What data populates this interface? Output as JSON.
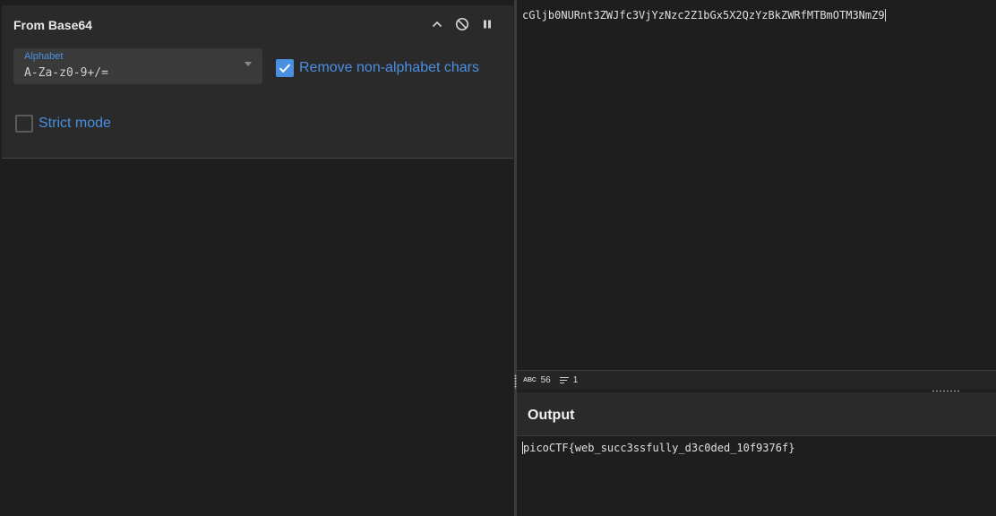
{
  "recipe": {
    "operation": {
      "title": "From Base64",
      "controls": {
        "collapse_icon": "chevron-up-icon",
        "disable_icon": "disable-icon",
        "pause_icon": "pause-icon"
      },
      "alphabet": {
        "label": "Alphabet",
        "value": "A-Za-z0-9+/="
      },
      "remove_non_alphabet": {
        "label": "Remove non-alphabet chars",
        "checked": true
      },
      "strict_mode": {
        "label": "Strict mode",
        "checked": false
      }
    }
  },
  "input": {
    "text": "cGljb0NURnt3ZWJfc3VjYzNzc2Z1bGx5X2QzYzBkZWRfMTBmOTM3NmZ9"
  },
  "status": {
    "abc_label": "ABC",
    "length": "56",
    "lines": "1"
  },
  "output": {
    "title": "Output",
    "text": "picoCTF{web_succ3ssfully_d3c0ded_10f9376f}"
  },
  "colors": {
    "accent": "#4a90e2",
    "background": "#1e1e1e",
    "panel": "#2a2a2a"
  }
}
